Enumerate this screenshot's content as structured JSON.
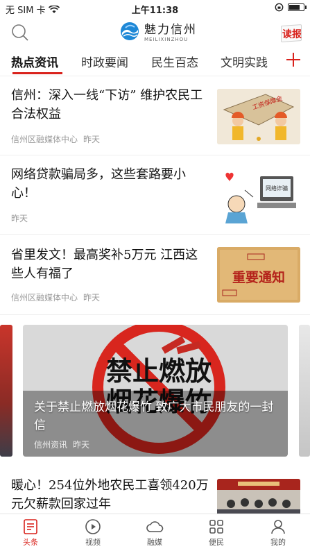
{
  "status_bar": {
    "carrier": "无 SIM 卡",
    "time": "上午11:38",
    "battery_level": 0.8
  },
  "header": {
    "brand_name": "魅力信州",
    "brand_pinyin": "MEILIXINZHOU",
    "read_label": "读报"
  },
  "tabs": [
    {
      "label": "热点资讯",
      "active": true
    },
    {
      "label": "时政要闻",
      "active": false
    },
    {
      "label": "民生百态",
      "active": false
    },
    {
      "label": "文明实践",
      "active": false
    }
  ],
  "news": [
    {
      "title": "信州：深入一线“下访” 维护农民工合法权益",
      "source": "信州区融媒体中心",
      "time": "昨天",
      "image_text": "工资保障金"
    },
    {
      "title": "网络贷款骗局多，这些套路要小心！",
      "source": "",
      "time": "昨天",
      "image_text": "网络诈骗"
    },
    {
      "title": "省里发文！最高奖补5万元 江西这些人有福了",
      "source": "信州区融媒体中心",
      "time": "昨天",
      "image_text": "重要通知"
    },
    {
      "title": "暖心！254位外地农民工喜领420万元欠薪款回家过年",
      "source": "",
      "time": "",
      "image_text": ""
    }
  ],
  "banner": {
    "image_text_1": "禁止燃放",
    "image_text_2": "烟花爆竹",
    "caption": "关于禁止燃放烟花爆竹 致广大市民朋友的一封信",
    "source": "信州资讯",
    "time": "昨天"
  },
  "bottom_nav": [
    {
      "label": "头条",
      "icon": "headline-icon",
      "active": true
    },
    {
      "label": "视频",
      "icon": "play-icon",
      "active": false
    },
    {
      "label": "融媒",
      "icon": "cloud-icon",
      "active": false
    },
    {
      "label": "便民",
      "icon": "grid-icon",
      "active": false
    },
    {
      "label": "我的",
      "icon": "user-icon",
      "active": false
    }
  ],
  "colors": {
    "accent": "#d9221c",
    "muted": "#999999"
  }
}
